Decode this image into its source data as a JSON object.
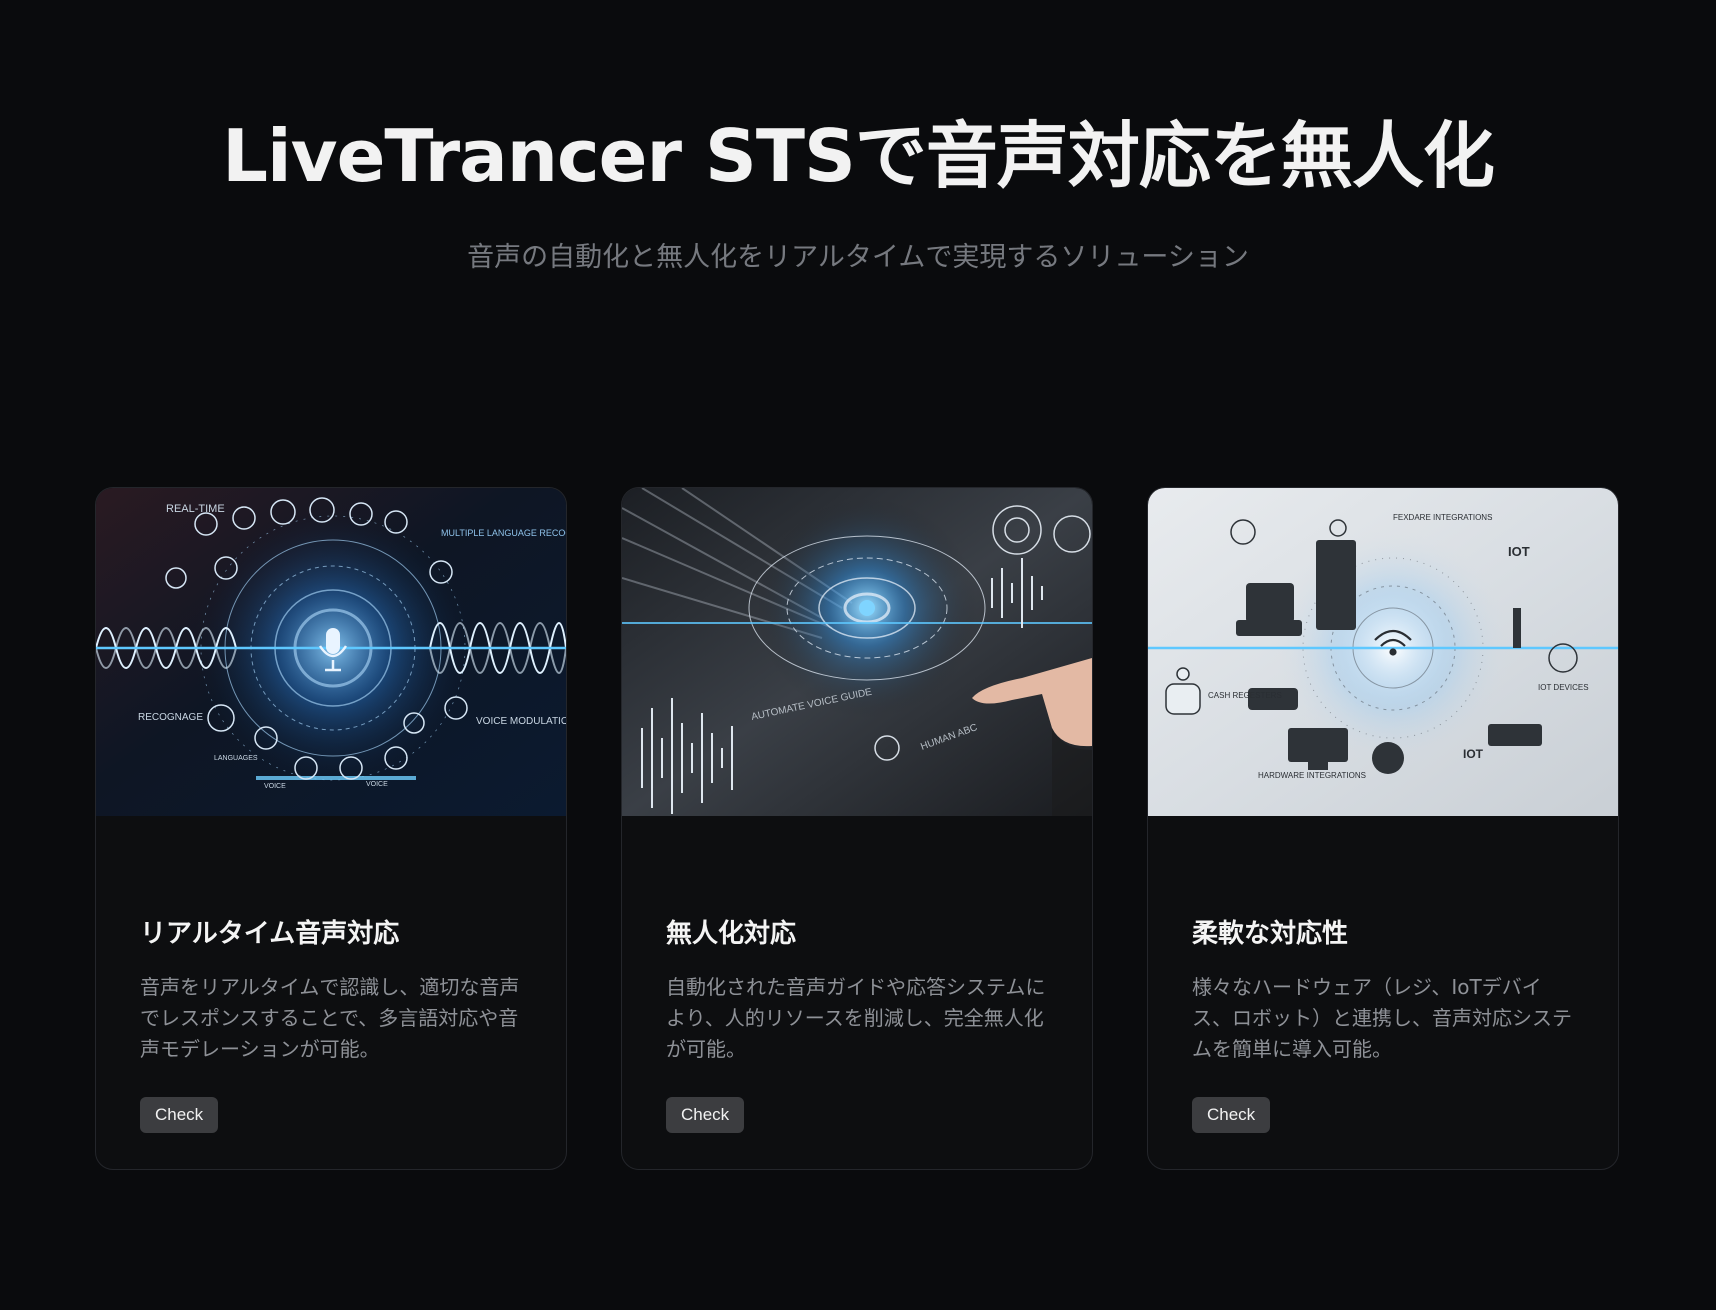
{
  "hero": {
    "title": "LiveTrancer STSで音声対応を無人化",
    "subtitle": "音声の自動化と無人化をリアルタイムで実現するソリューション"
  },
  "cards": [
    {
      "title": "リアルタイム音声対応",
      "description": "音声をリアルタイムで認識し、適切な音声でレスポンスすることで、多言語対応や音声モデレーションが可能。",
      "button_label": "Check",
      "image": {
        "icon": "microphone-icon",
        "labels": [
          "REAL-TIME",
          "MULTIPLE LANGUAGE RECOGNITION & REPONSE",
          "RECOGNAGE",
          "VOICE MODULATION",
          "LANGUAGES",
          "VOICE",
          "VOICE"
        ]
      }
    },
    {
      "title": "無人化対応",
      "description": "自動化された音声ガイドや応答システムにより、人的リソースを削減し、完全無人化が可能。",
      "button_label": "Check",
      "image": {
        "icon": "voice-guide-icon",
        "labels": [
          "AUTOMATE VOICE GUIDE",
          "HUMAN ABC"
        ]
      }
    },
    {
      "title": "柔軟な対応性",
      "description": "様々なハードウェア（レジ、IoTデバイス、ロボット）と連携し、音声対応システムを簡単に導入可能。",
      "button_label": "Check",
      "image": {
        "icon": "hardware-integration-icon",
        "labels": [
          "FEXDARE INTEGRATIONS",
          "IOT",
          "CASH REGESTERS",
          "IOT DEVICES",
          "HARDWARE INTEGRATIONS",
          "IOT"
        ]
      }
    }
  ],
  "colors": {
    "background": "#0a0b0d",
    "card_background": "#0d0e10",
    "button_background": "#3c3d40",
    "accent_blue": "#4fb3ff"
  }
}
